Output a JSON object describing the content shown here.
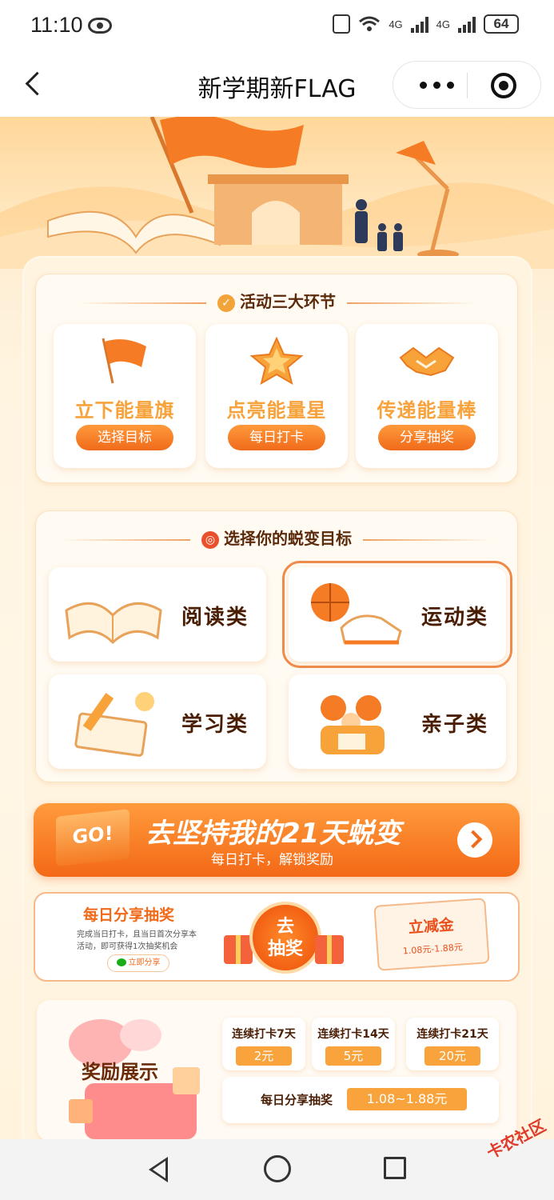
{
  "status_bar": {
    "time": "11:10",
    "network_1": "4G",
    "network_2": "4G",
    "battery": "64"
  },
  "title_bar": {
    "title": "新学期新FLAG"
  },
  "activity": {
    "title": "活动三大环节",
    "steps": [
      {
        "name": "立下能量旗",
        "action": "选择目标"
      },
      {
        "name": "点亮能量星",
        "action": "每日打卡"
      },
      {
        "name": "传递能量棒",
        "action": "分享抽奖"
      }
    ]
  },
  "goals": {
    "title": "选择你的蜕变目标",
    "items": [
      {
        "label": "阅读类"
      },
      {
        "label": "运动类"
      },
      {
        "label": "学习类"
      },
      {
        "label": "亲子类"
      }
    ],
    "selected": "运动类"
  },
  "go_banner": {
    "flag_text": "GO!",
    "title": "去坚持我的21天蜕变",
    "subtitle": "每日打卡，解锁奖励"
  },
  "share": {
    "title": "每日分享抽奖",
    "desc": "完成当日打卡，且当日首次分享本活动，即可获得1次抽奖机会",
    "button": "立即分享",
    "lottery_line1": "去",
    "lottery_line2": "抽奖",
    "coupon_title": "立减金",
    "coupon_value": "1.08元-1.88元"
  },
  "rewards": {
    "title": "奖励展示",
    "tiers": [
      {
        "name": "连续打卡7天",
        "prize": "2元"
      },
      {
        "name": "连续打卡14天",
        "prize": "5元"
      },
      {
        "name": "连续打卡21天",
        "prize": "20元"
      }
    ],
    "daily_name": "每日分享抽奖",
    "daily_prize": "1.08~1.88元"
  },
  "watermark": "卡农社区",
  "colors": {
    "accent": "#f06a1a",
    "accent_light": "#f9a33c",
    "background": "#fff4e0"
  }
}
